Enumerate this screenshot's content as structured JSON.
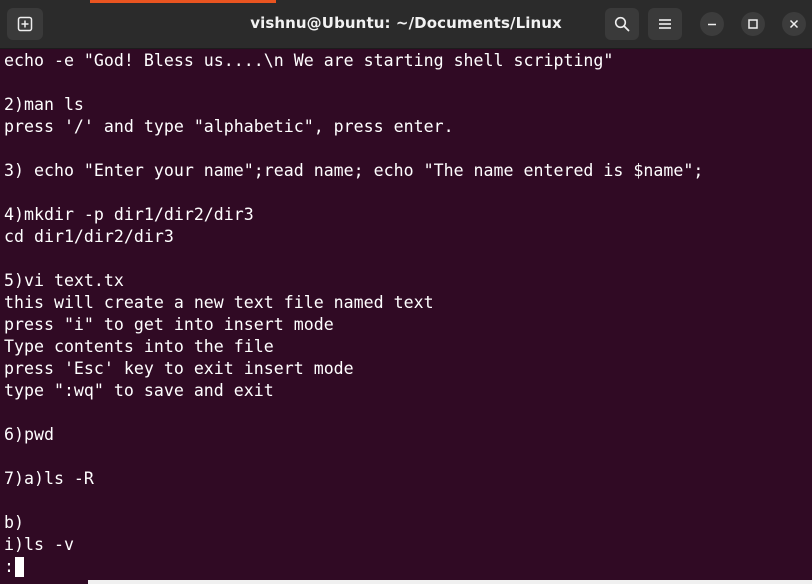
{
  "window": {
    "title": "vishnu@Ubuntu: ~/Documents/Linux",
    "accent_color": "#e95420",
    "terminal_bg": "#300a24",
    "titlebar_bg": "#2b2b2b"
  },
  "header_buttons": {
    "new_tab_icon": "new-tab-icon",
    "search_icon": "search-icon",
    "menu_icon": "hamburger-menu-icon",
    "minimize_icon": "minimize-icon",
    "maximize_icon": "maximize-icon",
    "close_icon": "close-icon"
  },
  "terminal": {
    "lines": [
      "echo -e \"God! Bless us....\\n We are starting shell scripting\"",
      "",
      "2)man ls",
      "press '/' and type \"alphabetic\", press enter.",
      "",
      "3) echo \"Enter your name\";read name; echo \"The name entered is $name\";",
      "",
      "4)mkdir -p dir1/dir2/dir3",
      "cd dir1/dir2/dir3",
      "",
      "5)vi text.tx",
      "this will create a new text file named text",
      "press \"i\" to get into insert mode",
      "Type contents into the file",
      "press 'Esc' key to exit insert mode",
      "type \":wq\" to save and exit",
      "",
      "6)pwd",
      "",
      "7)a)ls -R",
      "",
      "b)",
      "i)ls -v"
    ],
    "prompt": ":"
  }
}
